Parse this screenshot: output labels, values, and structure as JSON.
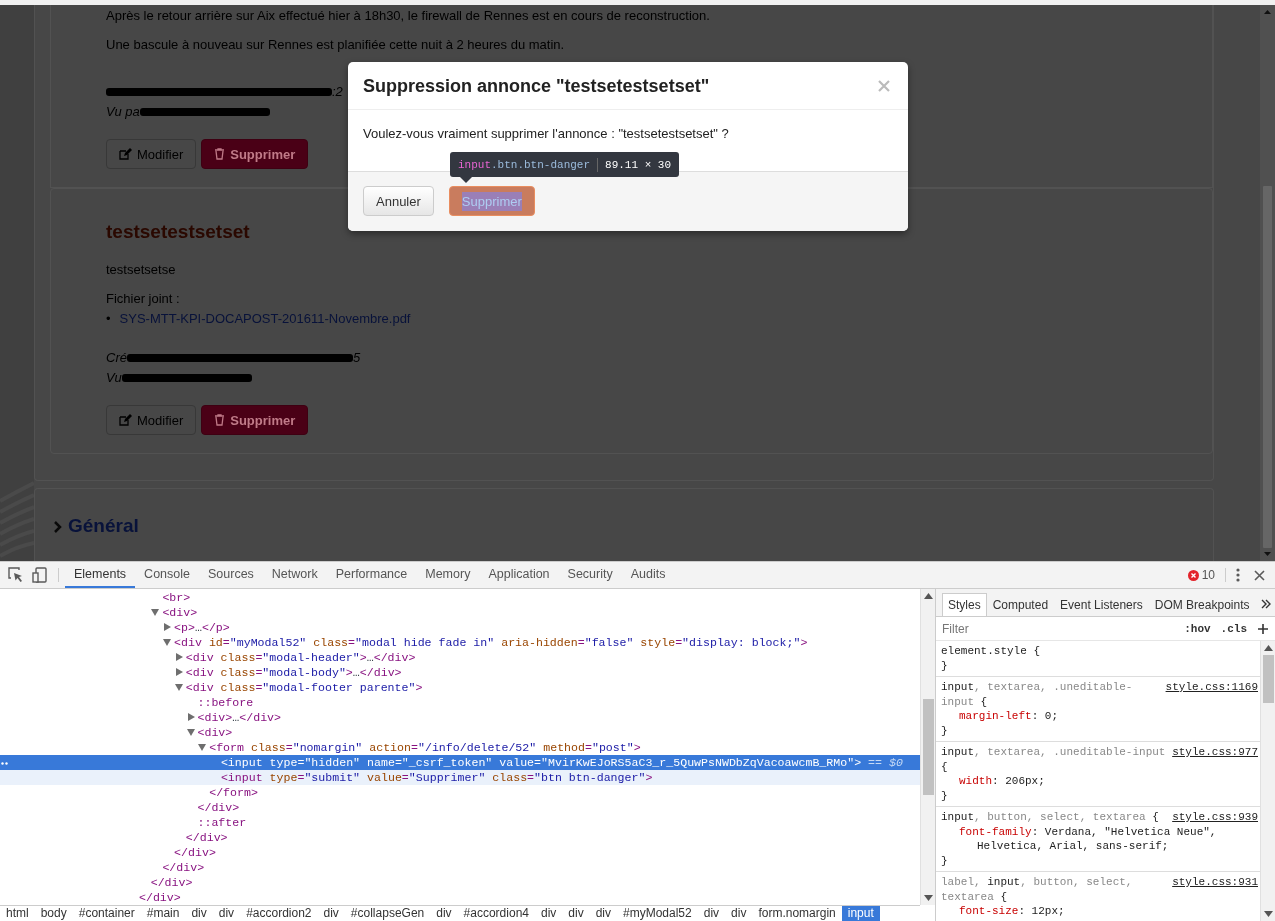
{
  "page": {
    "posts": [
      {
        "paragraphs": [
          "Après le retour arrière sur Aix effectué hier à 18h30, le firewall de Rennes est en cours de reconstruction.",
          "Une bascule à nouveau sur Rennes est planifiée cette nuit à 2 heures du matin."
        ],
        "meta": [
          {
            "kind": "created",
            "tail": ":2"
          },
          {
            "kind": "seen",
            "lead": "Vu pa"
          }
        ],
        "actions": [
          {
            "kind": "edit",
            "label": "Modifier"
          },
          {
            "kind": "delete",
            "label": "Supprimer"
          }
        ]
      },
      {
        "title": "testsetestsetset",
        "paragraphs": [
          "testsetsetse"
        ],
        "attachments_label": "Fichier joint :",
        "attachments": [
          {
            "bullet": "•",
            "name": "SYS-MTT-KPI-DOCAPOST-201611-Novembre.pdf"
          }
        ],
        "meta": [
          {
            "kind": "created",
            "lead": "Cré",
            "tail": "5"
          },
          {
            "kind": "seen",
            "lead": "Vu"
          }
        ],
        "actions": [
          {
            "kind": "edit",
            "label": "Modifier"
          },
          {
            "kind": "delete",
            "label": "Supprimer"
          }
        ]
      }
    ],
    "sections": [
      {
        "title": "Général",
        "expanded": false
      }
    ]
  },
  "modal": {
    "title": "Suppression annonce \"testsetestsetset\"",
    "message": "Voulez-vous vraiment supprimer l'annonce : \"testsetestsetset\" ?",
    "buttons": [
      {
        "kind": "cancel",
        "label": "Annuler",
        "inspected": false
      },
      {
        "kind": "danger",
        "label": "Supprimer",
        "inspected": true
      }
    ],
    "tooltip": {
      "tag": "input",
      "classes": ".btn.btn-danger",
      "size": "89.11 × 30"
    }
  },
  "devtools": {
    "tabs": [
      {
        "label": "Elements",
        "selected": true
      },
      {
        "label": "Console",
        "selected": false
      },
      {
        "label": "Sources",
        "selected": false
      },
      {
        "label": "Network",
        "selected": false
      },
      {
        "label": "Performance",
        "selected": false
      },
      {
        "label": "Memory",
        "selected": false
      },
      {
        "label": "Application",
        "selected": false
      },
      {
        "label": "Security",
        "selected": false
      },
      {
        "label": "Audits",
        "selected": false
      }
    ],
    "error_count": "10",
    "tree": [
      {
        "close": "</div>",
        "children": [
          {
            "close": "</div>",
            "children": [
              {
                "line": "<br>",
                "selected": false,
                "hovered": false
              },
              {
                "line": "<div>",
                "selected": false,
                "hovered": false,
                "expanded": true,
                "close": "</div>",
                "children": [
                  {
                    "line": "<p>…</p>",
                    "selected": false,
                    "hovered": false,
                    "expanded": false
                  },
                  {
                    "line": "<div id=\"myModal52\" class=\"modal hide fade in\" aria-hidden=\"false\" style=\"display: block;\">",
                    "selected": false,
                    "hovered": false,
                    "expanded": true,
                    "close": "</div>",
                    "children": [
                      {
                        "line": "<div class=\"modal-header\">…</div>",
                        "selected": false,
                        "hovered": false,
                        "expanded": false
                      },
                      {
                        "line": "<div class=\"modal-body\">…</div>",
                        "selected": false,
                        "hovered": false,
                        "expanded": false
                      },
                      {
                        "line": "<div class=\"modal-footer parente\">",
                        "selected": false,
                        "hovered": false,
                        "expanded": true,
                        "close": "</div>",
                        "children": [
                          {
                            "line": "::before",
                            "selected": false,
                            "hovered": false
                          },
                          {
                            "line": "<div>…</div>",
                            "selected": false,
                            "hovered": false,
                            "expanded": false
                          },
                          {
                            "line": "<div>",
                            "selected": false,
                            "hovered": false,
                            "expanded": true,
                            "close": "</div>",
                            "children": [
                              {
                                "line": "<form class=\"nomargin\" action=\"/info/delete/52\" method=\"post\">",
                                "selected": false,
                                "hovered": false,
                                "expanded": true,
                                "close": "</form>",
                                "children": [
                                  {
                                    "line": "<input type=\"hidden\" name=\"_csrf_token\" value=\"MvirKwEJoRS5aC3_r_5QuwPsNWDbZqVacoawcmB_RMo\">",
                                    "suffix": "== $0",
                                    "selected": true,
                                    "hovered": false
                                  },
                                  {
                                    "line": "<input type=\"submit\" value=\"Supprimer\" class=\"btn btn-danger\">",
                                    "selected": false,
                                    "hovered": true
                                  }
                                ]
                              }
                            ]
                          },
                          {
                            "line": "::after",
                            "selected": false,
                            "hovered": false
                          }
                        ]
                      }
                    ]
                  }
                ]
              }
            ]
          }
        ]
      }
    ],
    "styles": {
      "tabs": [
        {
          "label": "Styles",
          "selected": true
        },
        {
          "label": "Computed",
          "selected": false
        },
        {
          "label": "Event Listeners",
          "selected": false
        },
        {
          "label": "DOM Breakpoints",
          "selected": false
        }
      ],
      "placeholder": "Filter",
      "buttons": [
        ":hov",
        ".cls"
      ],
      "rules": [
        {
          "selector": [
            {
              "text": "element.style {",
              "matched": true
            }
          ],
          "close": "}"
        },
        {
          "selector": [
            {
              "text": "input",
              "matched": true
            },
            {
              "text": ", textarea, .uneditable-input",
              "matched": false
            },
            {
              "text": " {",
              "matched": true
            }
          ],
          "source": "style.css:1169",
          "props": [
            "margin-left: 0;"
          ],
          "close": "}"
        },
        {
          "selector": [
            {
              "text": "input",
              "matched": true
            },
            {
              "text": ", textarea, .uneditable-input",
              "matched": false
            },
            {
              "text": " {",
              "matched": true
            }
          ],
          "source": "style.css:977",
          "props": [
            "width: 206px;"
          ],
          "close": "}"
        },
        {
          "selector": [
            {
              "text": "input",
              "matched": true
            },
            {
              "text": ", button, select, textarea",
              "matched": false
            },
            {
              "text": " {",
              "matched": true
            }
          ],
          "source": "style.css:939",
          "props": [
            "font-family: Verdana, \"Helvetica Neue\", Helvetica, Arial, sans-serif;"
          ],
          "close": "}"
        },
        {
          "selector": [
            {
              "text": "label, ",
              "matched": false
            },
            {
              "text": "input",
              "matched": true
            },
            {
              "text": ", button, select, textarea",
              "matched": false
            },
            {
              "text": " {",
              "matched": true
            }
          ],
          "source": "style.css:931",
          "props": [
            "font-size: 12px;"
          ]
        }
      ]
    },
    "breadcrumb": [
      {
        "label": "html",
        "selected": false
      },
      {
        "label": "body",
        "selected": false
      },
      {
        "label": "#container",
        "selected": false
      },
      {
        "label": "#main",
        "selected": false
      },
      {
        "label": "div",
        "selected": false
      },
      {
        "label": "div",
        "selected": false
      },
      {
        "label": "#accordion2",
        "selected": false
      },
      {
        "label": "div",
        "selected": false
      },
      {
        "label": "#collapseGen",
        "selected": false
      },
      {
        "label": "div",
        "selected": false
      },
      {
        "label": "#accordion4",
        "selected": false
      },
      {
        "label": "div",
        "selected": false
      },
      {
        "label": "div",
        "selected": false
      },
      {
        "label": "div",
        "selected": false
      },
      {
        "label": "#myModal52",
        "selected": false
      },
      {
        "label": "div",
        "selected": false
      },
      {
        "label": "div",
        "selected": false
      },
      {
        "label": "form.nomargin",
        "selected": false
      },
      {
        "label": "input",
        "selected": true
      }
    ]
  }
}
